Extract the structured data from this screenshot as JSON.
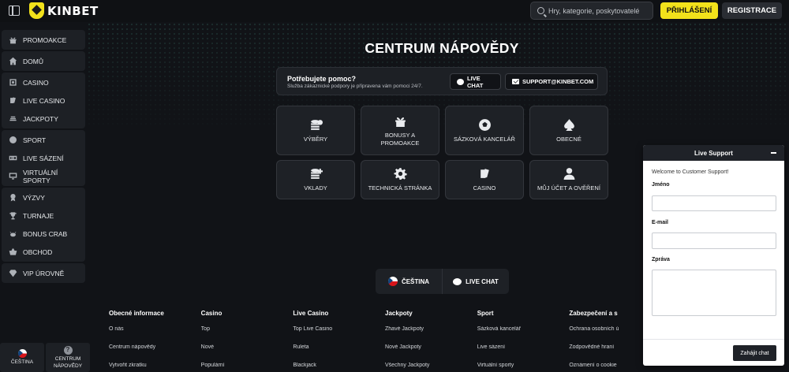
{
  "header": {
    "brand": "KINBET",
    "search_placeholder": "Hry, kategorie, poskytovatelé",
    "login_label": "PŘIHLÁŠENÍ",
    "register_label": "REGISTRACE"
  },
  "sidebar": {
    "groups": [
      [
        {
          "label": "PROMOAKCE",
          "icon": "gift-icon"
        }
      ],
      [
        {
          "label": "DOMŮ",
          "icon": "home-icon"
        }
      ],
      [
        {
          "label": "CASINO",
          "icon": "casino-icon"
        },
        {
          "label": "LIVE CASINO",
          "icon": "cards-icon"
        },
        {
          "label": "JACKPOTY",
          "icon": "coins-icon"
        }
      ],
      [
        {
          "label": "SPORT",
          "icon": "ball-icon"
        },
        {
          "label": "LIVE SÁZENÍ",
          "icon": "live-icon"
        },
        {
          "label": "VIRTUÁLNÍ SPORTY",
          "icon": "monitor-icon"
        }
      ],
      [
        {
          "label": "VÝZVY",
          "icon": "medal-icon"
        },
        {
          "label": "TURNAJE",
          "icon": "trophy-icon"
        },
        {
          "label": "BONUS CRAB",
          "icon": "crab-icon"
        },
        {
          "label": "OBCHOD",
          "icon": "basket-icon"
        }
      ],
      [
        {
          "label": "VIP ÚROVNĚ",
          "icon": "diamond-icon"
        }
      ]
    ],
    "language_label": "ČEŠTINA",
    "help_label_1": "CENTRUM",
    "help_label_2": "NÁPOVĚDY"
  },
  "main": {
    "title": "CENTRUM NÁPOVĚDY",
    "banner": {
      "title": "Potřebujete pomoc?",
      "subtitle": "Služba zákaznické podpory je připravena vám pomoci 24/7.",
      "chat_label": "LIVE CHAT",
      "email_label": "SUPPORT@KINBET.COM"
    },
    "categories": [
      {
        "label": "VÝBĚRY",
        "icon": "coins-stack-icon"
      },
      {
        "label": "BONUSY A PROMOAKCE",
        "icon": "gift-icon"
      },
      {
        "label": "SÁZKOVÁ KANCELÁŘ",
        "icon": "soccer-ball-icon"
      },
      {
        "label": "OBECNÉ",
        "icon": "spade-icon"
      },
      {
        "label": "VKLADY",
        "icon": "coins-plus-icon"
      },
      {
        "label": "TECHNICKÁ STRÁNKA",
        "icon": "gear-icon"
      },
      {
        "label": "CASINO",
        "icon": "cards-icon"
      },
      {
        "label": "MŮJ ÚČET A OVĚŘENÍ",
        "icon": "user-icon"
      }
    ],
    "lang_bar": {
      "language": "ČEŠTINA",
      "chat": "LIVE CHAT"
    }
  },
  "footer": {
    "columns": [
      {
        "title": "Obecné informace",
        "links": [
          "O nás",
          "Centrum nápovědy",
          "Vytvořit zkratku"
        ]
      },
      {
        "title": "Casino",
        "links": [
          "Top",
          "Nové",
          "Populární"
        ]
      },
      {
        "title": "Live Casino",
        "links": [
          "Top Live Casino",
          "Ruleta",
          "Blackjack"
        ]
      },
      {
        "title": "Jackpoty",
        "links": [
          "Žhavé Jackpoty",
          "Nové Jackpoty",
          "Všechny Jackpoty"
        ]
      },
      {
        "title": "Sport",
        "links": [
          "Sázková kancelář",
          "Live sázení",
          "Virtuální sporty"
        ]
      },
      {
        "title": "Zabezpečení a s",
        "links": [
          "Ochrana osobních ú",
          "Zodpovědné hraní",
          "Oznámení o cookie"
        ]
      }
    ]
  },
  "support": {
    "title": "Live Support",
    "welcome": "Welcome to Customer Support!",
    "name_label": "Jméno",
    "email_label": "E-mail",
    "message_label": "Zpráva",
    "start_label": "Zahájit chat",
    "name_value": "",
    "email_value": "",
    "message_value": ""
  },
  "colors": {
    "accent": "#f2e21b",
    "background": "#111317",
    "panel": "#1d2025"
  }
}
